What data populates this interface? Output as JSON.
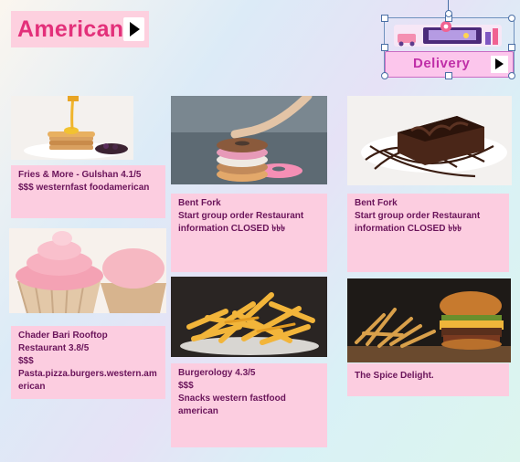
{
  "header": {
    "title": "American",
    "delivery_label": "Delivery"
  },
  "colors": {
    "title": "#e3307a",
    "card_bg": "#fccde0",
    "card_text": "#6a145a",
    "delivery_bg": "#fcc6ec"
  },
  "cards": [
    {
      "image": "pancakes-syrup-photo",
      "lines": [
        "Fries & More - Gulshan 4.1/5",
        "$$$ westernfast foodamerican"
      ]
    },
    {
      "image": "cupcakes-photo",
      "lines": [
        "Chader Bari Rooftop",
        "Restaurant 3.8/5",
        "$$$",
        "Pasta.pizza.burgers.western.am",
        "erican"
      ]
    },
    {
      "image": "donut-stack-photo",
      "lines": [
        "Bent Fork",
        "Start group order Restaurant",
        "information CLOSED ৳৳৳"
      ]
    },
    {
      "image": "fries-photo",
      "lines": [
        "Burgerology 4.3/5",
        "$$$",
        "Snacks western fastfood",
        "american"
      ]
    },
    {
      "image": "chocolate-brownie-photo",
      "lines": [
        "Bent Fork",
        "Start group order Restaurant",
        "information CLOSED ৳৳৳"
      ]
    },
    {
      "image": "burger-fries-photo",
      "lines": [
        "The Spice Delight."
      ]
    }
  ]
}
